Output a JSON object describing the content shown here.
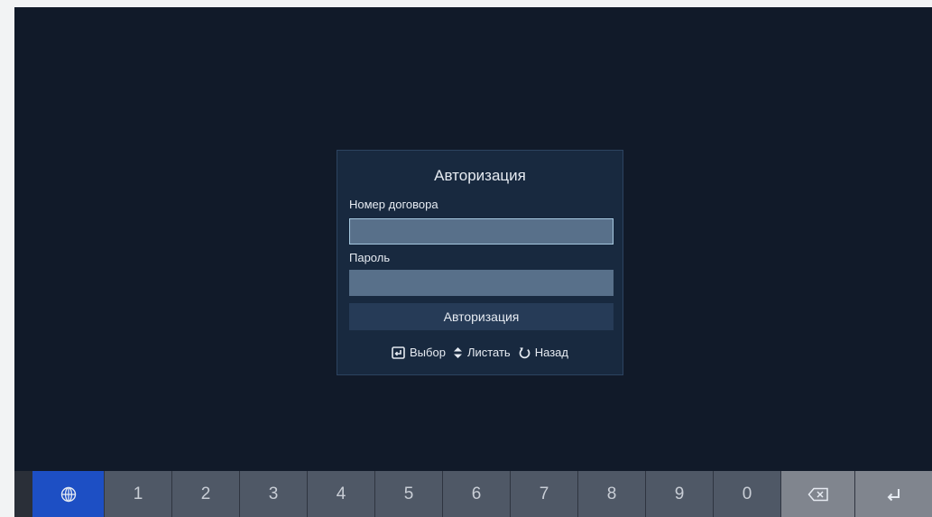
{
  "dialog": {
    "title": "Авторизация",
    "contract_label": "Номер договора",
    "contract_value": "",
    "password_label": "Пароль",
    "password_value": "",
    "submit_label": "Авторизация"
  },
  "hints": {
    "select": "Выбор",
    "scroll": "Листать",
    "back": "Назад"
  },
  "keyboard": {
    "lang_icon": "globe-icon",
    "keys": [
      "1",
      "2",
      "3",
      "4",
      "5",
      "6",
      "7",
      "8",
      "9",
      "0"
    ],
    "backspace_icon": "backspace-icon",
    "enter_icon": "enter-icon"
  },
  "colors": {
    "background": "#111a29",
    "dialog": "#18293f",
    "field": "#58708a",
    "accent": "#1d4fc4"
  }
}
